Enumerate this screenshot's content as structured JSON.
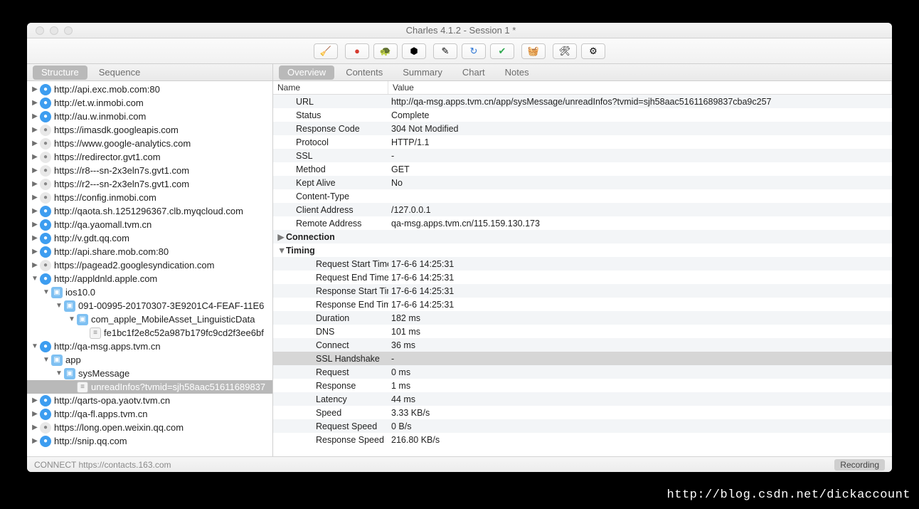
{
  "window": {
    "title": "Charles 4.1.2 - Session 1 *"
  },
  "left_tabs": {
    "structure": "Structure",
    "sequence": "Sequence"
  },
  "right_tabs": {
    "overview": "Overview",
    "contents": "Contents",
    "summary": "Summary",
    "chart": "Chart",
    "notes": "Notes"
  },
  "columns": {
    "name": "Name",
    "value": "Value"
  },
  "status": {
    "left": "CONNECT https://contacts.163.com",
    "right": "Recording"
  },
  "watermark": "http://blog.csdn.net/dickaccount",
  "tree": [
    {
      "d": 0,
      "t": "r",
      "i": "globe",
      "l": "http://api.exc.mob.com:80"
    },
    {
      "d": 0,
      "t": "r",
      "i": "globe",
      "l": "http://et.w.inmobi.com"
    },
    {
      "d": 0,
      "t": "r",
      "i": "globe",
      "l": "http://au.w.inmobi.com"
    },
    {
      "d": 0,
      "t": "r",
      "i": "globe2",
      "l": "https://imasdk.googleapis.com"
    },
    {
      "d": 0,
      "t": "r",
      "i": "globe2",
      "l": "https://www.google-analytics.com"
    },
    {
      "d": 0,
      "t": "r",
      "i": "globe2",
      "l": "https://redirector.gvt1.com"
    },
    {
      "d": 0,
      "t": "r",
      "i": "globe2",
      "l": "https://r8---sn-2x3eln7s.gvt1.com"
    },
    {
      "d": 0,
      "t": "r",
      "i": "globe2",
      "l": "https://r2---sn-2x3eln7s.gvt1.com"
    },
    {
      "d": 0,
      "t": "r",
      "i": "globe2",
      "l": "https://config.inmobi.com"
    },
    {
      "d": 0,
      "t": "r",
      "i": "globe",
      "l": "http://qaota.sh.1251296367.clb.myqcloud.com"
    },
    {
      "d": 0,
      "t": "r",
      "i": "globe",
      "l": "http://qa.yaomall.tvm.cn"
    },
    {
      "d": 0,
      "t": "r",
      "i": "globe",
      "l": "http://v.gdt.qq.com"
    },
    {
      "d": 0,
      "t": "r",
      "i": "globe",
      "l": "http://api.share.mob.com:80"
    },
    {
      "d": 0,
      "t": "r",
      "i": "globe2",
      "l": "https://pagead2.googlesyndication.com"
    },
    {
      "d": 0,
      "t": "d",
      "i": "globe",
      "l": "http://appldnld.apple.com"
    },
    {
      "d": 1,
      "t": "d",
      "i": "fold",
      "l": "ios10.0"
    },
    {
      "d": 2,
      "t": "d",
      "i": "fold",
      "l": "091-00995-20170307-3E9201C4-FEAF-11E6"
    },
    {
      "d": 3,
      "t": "d",
      "i": "fold",
      "l": "com_apple_MobileAsset_LinguisticData"
    },
    {
      "d": 4,
      "t": "",
      "i": "file",
      "l": "fe1bc1f2e8c52a987b179fc9cd2f3ee6bf"
    },
    {
      "d": 0,
      "t": "d",
      "i": "globe",
      "l": "http://qa-msg.apps.tvm.cn"
    },
    {
      "d": 1,
      "t": "d",
      "i": "fold",
      "l": "app"
    },
    {
      "d": 2,
      "t": "d",
      "i": "fold",
      "l": "sysMessage"
    },
    {
      "d": 3,
      "t": "",
      "i": "file",
      "l": "unreadInfos?tvmid=sjh58aac51611689837",
      "sel": true
    },
    {
      "d": 0,
      "t": "r",
      "i": "globe",
      "l": "http://qarts-opa.yaotv.tvm.cn"
    },
    {
      "d": 0,
      "t": "r",
      "i": "globe",
      "l": "http://qa-fl.apps.tvm.cn"
    },
    {
      "d": 0,
      "t": "r",
      "i": "globe2",
      "l": "https://long.open.weixin.qq.com"
    },
    {
      "d": 0,
      "t": "r",
      "i": "globe",
      "l": "http://snip.qq.com"
    }
  ],
  "overview": {
    "top": [
      {
        "k": "URL",
        "v": "http://qa-msg.apps.tvm.cn/app/sysMessage/unreadInfos?tvmid=sjh58aac51611689837cba9c257"
      },
      {
        "k": "Status",
        "v": "Complete"
      },
      {
        "k": "Response Code",
        "v": "304 Not Modified"
      },
      {
        "k": "Protocol",
        "v": "HTTP/1.1"
      },
      {
        "k": "SSL",
        "v": "-"
      },
      {
        "k": "Method",
        "v": "GET"
      },
      {
        "k": "Kept Alive",
        "v": "No"
      },
      {
        "k": "Content-Type",
        "v": ""
      },
      {
        "k": "Client Address",
        "v": "/127.0.0.1"
      },
      {
        "k": "Remote Address",
        "v": "qa-msg.apps.tvm.cn/115.159.130.173"
      }
    ],
    "groups": [
      {
        "name": "Connection",
        "open": false,
        "items": []
      },
      {
        "name": "Timing",
        "open": true,
        "items": [
          {
            "k": "Request Start Time",
            "v": "17-6-6 14:25:31"
          },
          {
            "k": "Request End Time",
            "v": "17-6-6 14:25:31"
          },
          {
            "k": "Response Start Time",
            "v": "17-6-6 14:25:31"
          },
          {
            "k": "Response End Time",
            "v": "17-6-6 14:25:31"
          },
          {
            "k": "Duration",
            "v": "182 ms"
          },
          {
            "k": "DNS",
            "v": "101 ms"
          },
          {
            "k": "Connect",
            "v": "36 ms"
          },
          {
            "k": "SSL Handshake",
            "v": "-",
            "sel": true
          },
          {
            "k": "Request",
            "v": "0 ms"
          },
          {
            "k": "Response",
            "v": "1 ms"
          },
          {
            "k": "Latency",
            "v": "44 ms"
          },
          {
            "k": "Speed",
            "v": "3.33 KB/s"
          },
          {
            "k": "Request Speed",
            "v": "0 B/s"
          },
          {
            "k": "Response Speed",
            "v": "216.80 KB/s"
          }
        ]
      }
    ]
  }
}
